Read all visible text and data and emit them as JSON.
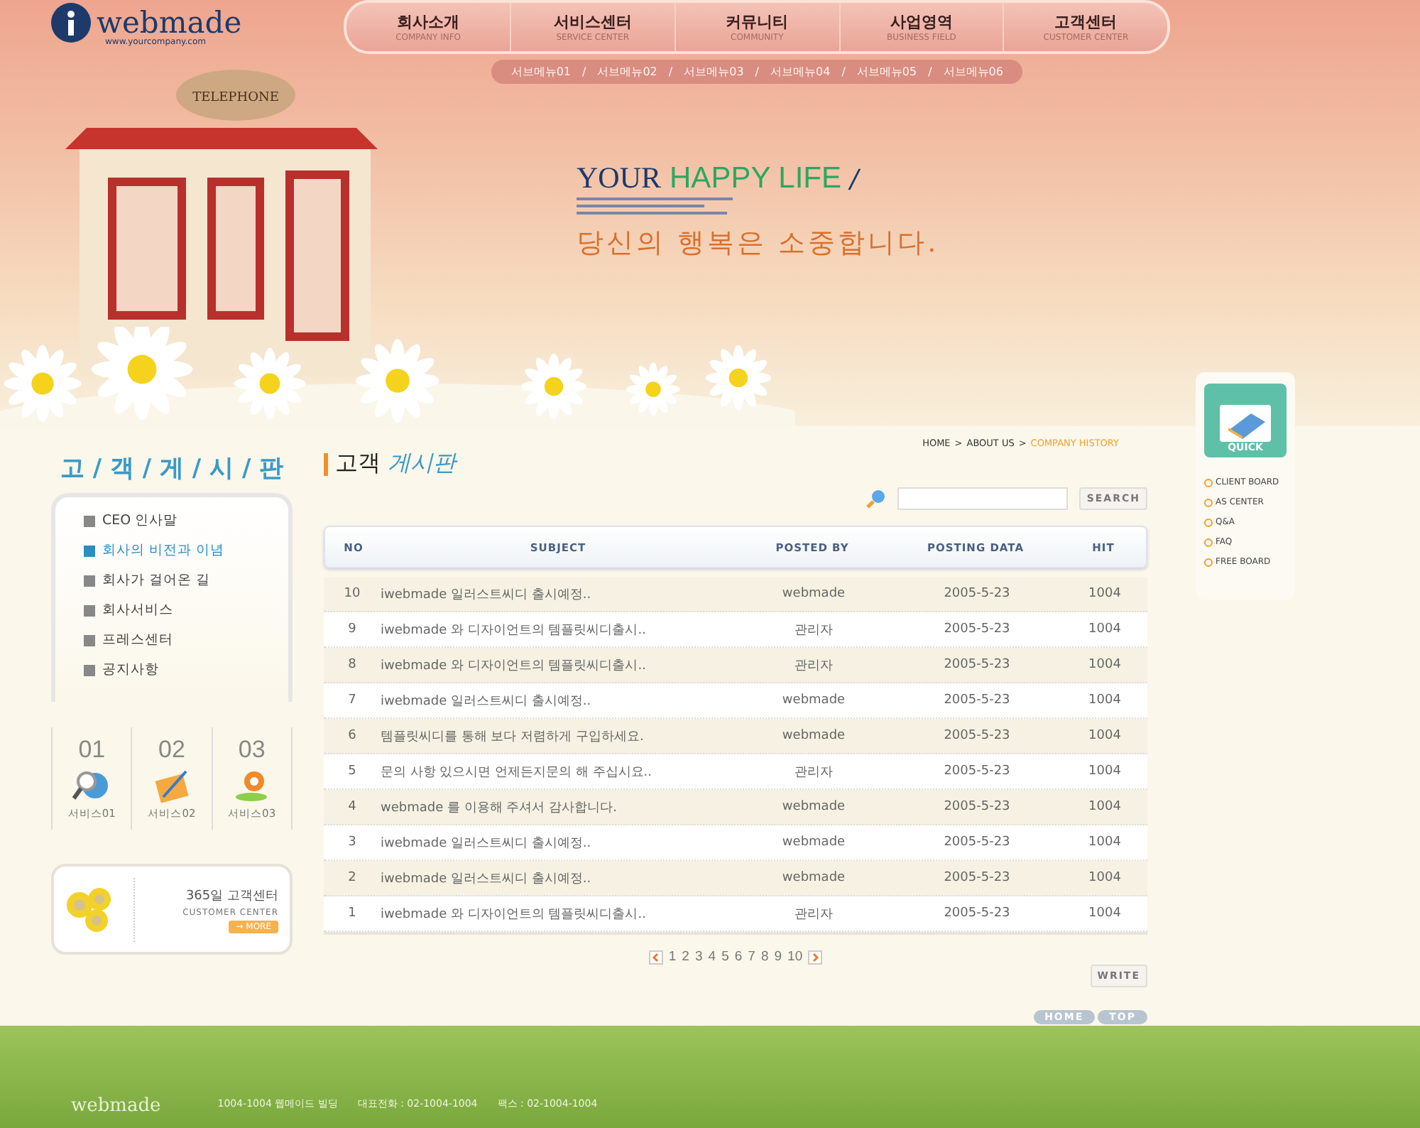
{
  "logo": {
    "name": "webmade",
    "url": "www.yourcompany.com"
  },
  "nav": [
    {
      "label": "회사소개",
      "sublabel": "COMPANY INFO"
    },
    {
      "label": "서비스센터",
      "sublabel": "SERVICE CENTER"
    },
    {
      "label": "커뮤니티",
      "sublabel": "COMMUNITY"
    },
    {
      "label": "사업영역",
      "sublabel": "BUSINESS FIELD"
    },
    {
      "label": "고객센터",
      "sublabel": "CUSTOMER CENTER"
    }
  ],
  "submenu_separator": "/",
  "submenu": [
    "서브메뉴01",
    "서브메뉴02",
    "서브메뉴03",
    "서브메뉴04",
    "서브메뉴05",
    "서브메뉴06"
  ],
  "hero": {
    "sign": "TELEPHONE",
    "headline_1": "YOUR",
    "headline_2": "HAPPY LIFE",
    "headline_mark": "/",
    "slogan": "당신의 행복은 소중합니다."
  },
  "sidebar": {
    "title": "고 / 객 / 게 / 시 / 판",
    "menu": [
      {
        "label": "CEO 인사말",
        "selected": false
      },
      {
        "label": "회사의 비전과 이념",
        "selected": true
      },
      {
        "label": "회사가 걸어온 길",
        "selected": false
      },
      {
        "label": "회사서비스",
        "selected": false
      },
      {
        "label": "프레스센터",
        "selected": false
      },
      {
        "label": "공지사항",
        "selected": false
      }
    ],
    "services": [
      {
        "number": "01",
        "label": "서비스01"
      },
      {
        "number": "02",
        "label": "서비스02"
      },
      {
        "number": "03",
        "label": "서비스03"
      }
    ],
    "customer_center": {
      "title": "365일 고객센터",
      "subtitle": "CUSTOMER CENTER",
      "more": "→ MORE"
    }
  },
  "breadcrumb": [
    {
      "label": "HOME",
      "current": false
    },
    {
      "label": "ABOUT US",
      "current": false
    },
    {
      "label": "COMPANY HISTORY",
      "current": true
    }
  ],
  "breadcrumb_separator": ">",
  "page_title": {
    "part_1": "고객",
    "part_2": "게시판"
  },
  "search": {
    "button": "SEARCH"
  },
  "table": {
    "columns": [
      "NO",
      "SUBJECT",
      "POSTED BY",
      "POSTING DATA",
      "HIT"
    ],
    "rows": [
      [
        "10",
        "iwebmade 일러스트씨디 출시예정..",
        "webmade",
        "2005-5-23",
        "1004"
      ],
      [
        "9",
        "iwebmade 와 디자이언트의 템플릿씨디출시..",
        "관리자",
        "2005-5-23",
        "1004"
      ],
      [
        "8",
        "iwebmade 와 디자이언트의 템플릿씨디출시..",
        "관리자",
        "2005-5-23",
        "1004"
      ],
      [
        "7",
        "iwebmade 일러스트씨디 출시예정..",
        "webmade",
        "2005-5-23",
        "1004"
      ],
      [
        "6",
        "템플릿씨디를 통해 보다 저렴하게 구입하세요.",
        "webmade",
        "2005-5-23",
        "1004"
      ],
      [
        "5",
        "문의 사항 있으시면 언제든지문의 해 주십시요..",
        "관리자",
        "2005-5-23",
        "1004"
      ],
      [
        "4",
        "webmade 를 이용해 주셔서 감사합니다.",
        "webmade",
        "2005-5-23",
        "1004"
      ],
      [
        "3",
        "iwebmade 일러스트씨디 출시예정..",
        "webmade",
        "2005-5-23",
        "1004"
      ],
      [
        "2",
        "iwebmade 일러스트씨디 출시예정..",
        "webmade",
        "2005-5-23",
        "1004"
      ],
      [
        "1",
        "iwebmade 와 디자이언트의 템플릿씨디출시..",
        "관리자",
        "2005-5-23",
        "1004"
      ]
    ]
  },
  "pagination": [
    "1",
    "2",
    "3",
    "4",
    "5",
    "6",
    "7",
    "8",
    "9",
    "10"
  ],
  "write_button": "WRITE",
  "bottom_buttons": [
    "HOME",
    "TOP"
  ],
  "quick": {
    "title": "QUICK",
    "items": [
      "CLIENT BOARD",
      "AS CENTER",
      "Q&A",
      "FAQ",
      "FREE BOARD"
    ]
  },
  "footer": {
    "logo": "webmade",
    "address": [
      "1004-1004 웹메이드 빌딩",
      "대표전화 : 02-1004-1004",
      "팩스 : 02-1004-1004"
    ]
  }
}
